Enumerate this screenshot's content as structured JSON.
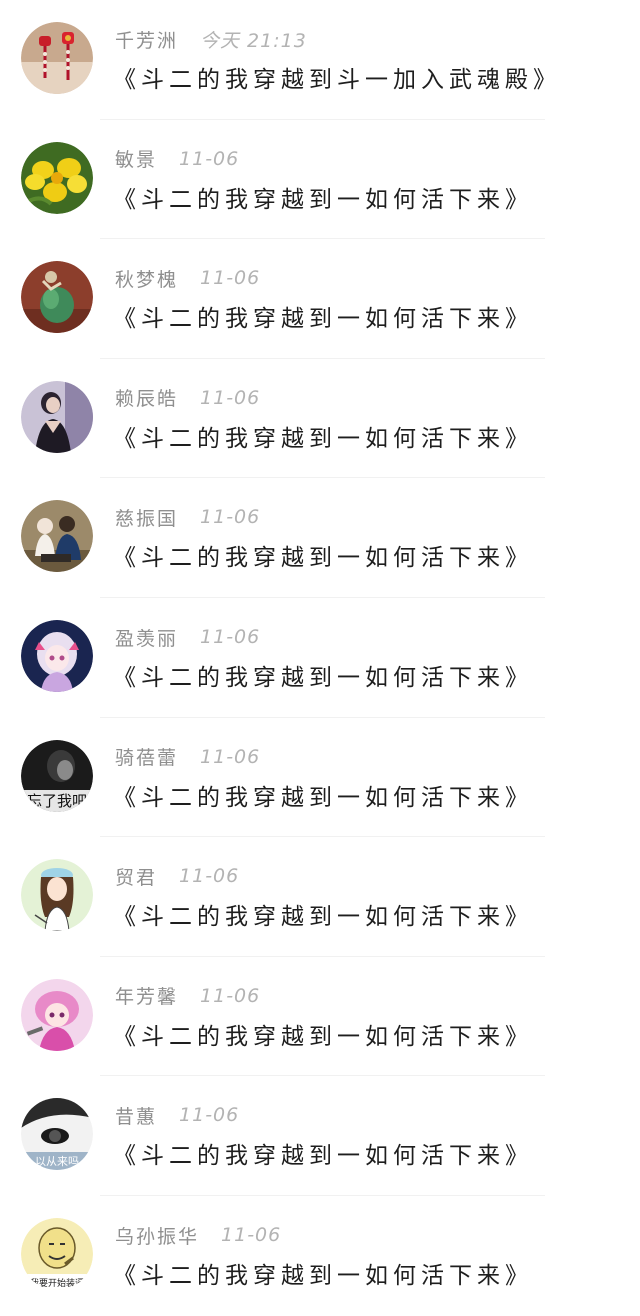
{
  "comments": [
    {
      "name": "千芳洲",
      "time": "今天 21:13",
      "message": "《斗二的我穿越到斗一加入武魂殿》",
      "avatar": "lantern-avatar"
    },
    {
      "name": "敏景",
      "time": "11-06",
      "message": "《斗二的我穿越到一如何活下来》",
      "avatar": "yellow-flower-avatar"
    },
    {
      "name": "秋梦槐",
      "time": "11-06",
      "message": "《斗二的我穿越到一如何活下来》",
      "avatar": "green-figurine-avatar"
    },
    {
      "name": "赖辰皓",
      "time": "11-06",
      "message": "《斗二的我穿越到一如何活下来》",
      "avatar": "girl-photo-avatar"
    },
    {
      "name": "慈振国",
      "time": "11-06",
      "message": "《斗二的我穿越到一如何活下来》",
      "avatar": "couple-photo-avatar"
    },
    {
      "name": "盈羡丽",
      "time": "11-06",
      "message": "《斗二的我穿越到一如何活下来》",
      "avatar": "anime-girl-avatar"
    },
    {
      "name": "骑蓓蕾",
      "time": "11-06",
      "message": "《斗二的我穿越到一如何活下来》",
      "avatar": "bw-text-avatar",
      "avatar_text": "忘了我吧"
    },
    {
      "name": "贸君",
      "time": "11-06",
      "message": "《斗二的我穿越到一如何活下来》",
      "avatar": "cartoon-girl-avatar"
    },
    {
      "name": "年芳馨",
      "time": "11-06",
      "message": "《斗二的我穿越到一如何活下来》",
      "avatar": "pink-anime-avatar"
    },
    {
      "name": "昔蕙",
      "time": "11-06",
      "message": "《斗二的我穿越到一如何活下来》",
      "avatar": "bw-eye-avatar",
      "avatar_text": "以从来吗"
    },
    {
      "name": "乌孙振华",
      "time": "11-06",
      "message": "《斗二的我穿越到一如何活下来》",
      "avatar": "meme-face-avatar",
      "avatar_text": "我要开始装逼"
    }
  ]
}
